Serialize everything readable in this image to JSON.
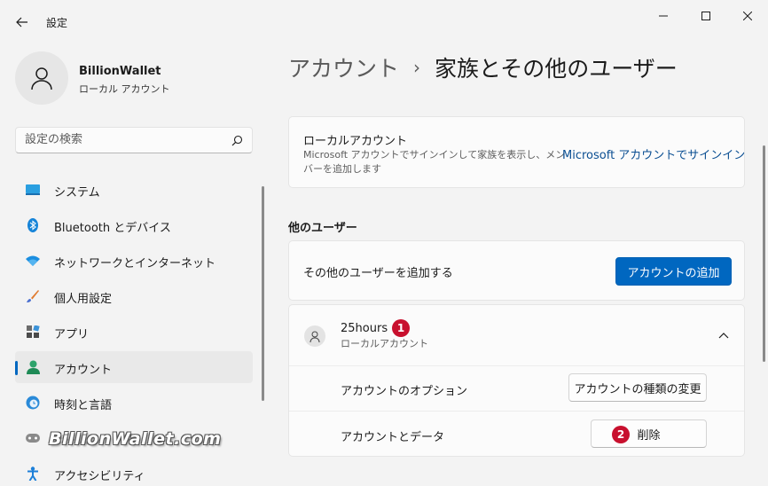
{
  "window": {
    "title": "設定",
    "controls": [
      "minimize-icon",
      "maximize-icon",
      "close-icon"
    ]
  },
  "profile": {
    "name": "BillionWallet",
    "account_type": "ローカル アカウント"
  },
  "search": {
    "placeholder": "設定の検索"
  },
  "nav": {
    "items": [
      {
        "label": "システム",
        "icon": "system-icon"
      },
      {
        "label": "Bluetooth とデバイス",
        "icon": "bluetooth-icon"
      },
      {
        "label": "ネットワークとインターネット",
        "icon": "network-icon"
      },
      {
        "label": "個人用設定",
        "icon": "personalization-icon"
      },
      {
        "label": "アプリ",
        "icon": "apps-icon"
      },
      {
        "label": "アカウント",
        "icon": "accounts-icon",
        "active": true
      },
      {
        "label": "時刻と言語",
        "icon": "time-language-icon"
      },
      {
        "label": "ゲーム",
        "icon": "gaming-icon"
      },
      {
        "label": "アクセシビリティ",
        "icon": "accessibility-icon"
      }
    ]
  },
  "breadcrumb": {
    "parent": "アカウント",
    "separator": "›",
    "current": "家族とその他のユーザー"
  },
  "local_account_card": {
    "title": "ローカルアカウント",
    "description_line1": "Microsoft アカウントでサインインして家族を表示し、メン",
    "description_line2": "バーを追加します",
    "link": "Microsoft アカウントでサインイン"
  },
  "other_users": {
    "heading": "他のユーザー",
    "add_label": "その他のユーザーを追加する",
    "add_button": "アカウントの追加"
  },
  "user_entry": {
    "name": "25hours",
    "type": "ローカルアカウント",
    "badge": "1",
    "options_label": "アカウントのオプション",
    "change_type_button": "アカウントの種類の変更",
    "data_label": "アカウントとデータ",
    "delete_button": "削除",
    "delete_badge": "2"
  },
  "watermark": "BillionWallet.com",
  "colors": {
    "accent": "#0067c0",
    "badge": "#c8102e",
    "link": "#0a4e92"
  }
}
